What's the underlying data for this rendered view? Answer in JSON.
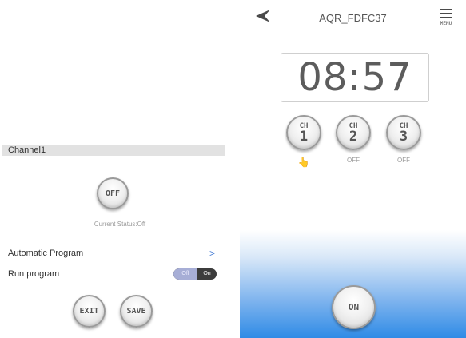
{
  "left_panel": {
    "channel_header": "Channel1",
    "off_button": "OFF",
    "current_status": "Current Status:Off",
    "automatic_program": "Automatic Program",
    "automatic_chevron": ">",
    "run_program": "Run program",
    "toggle_off": "Off",
    "toggle_on": "On",
    "exit_button": "EXIT",
    "save_button": "SAVE"
  },
  "right_panel": {
    "title": "AQR_FDFC37",
    "menu_label": "MENU",
    "clock": "08:57",
    "channels": [
      {
        "label": "CH",
        "number": "1",
        "status": "👆"
      },
      {
        "label": "CH",
        "number": "2",
        "status": "OFF"
      },
      {
        "label": "CH",
        "number": "3",
        "status": "OFF"
      }
    ],
    "on_button": "ON"
  },
  "colors": {
    "accent_blue": "#2f8be6",
    "chevron_blue": "#4a7fd6",
    "toggle_dark": "#3c3c3c",
    "toggle_off_bg": "#a7aed6",
    "header_gray": "#e2e2e2"
  },
  "icons": {
    "back": "back-arrow-icon",
    "menu": "hamburger-menu-icon",
    "hand": "hand-pointer-icon"
  }
}
